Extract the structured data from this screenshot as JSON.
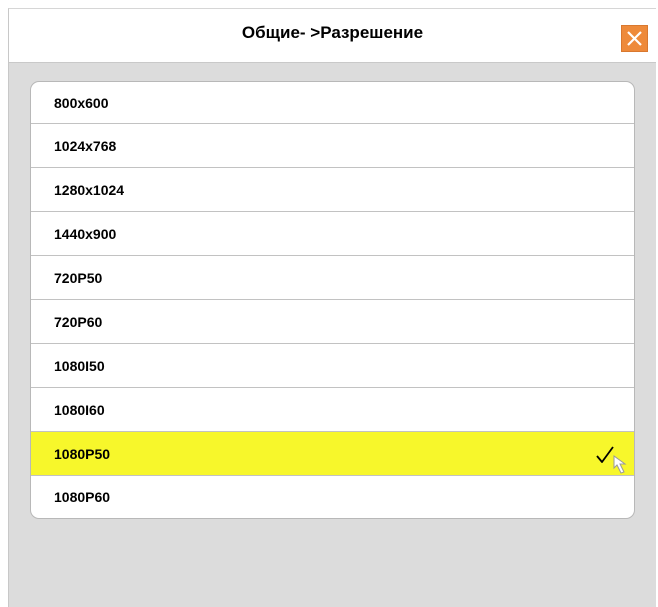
{
  "window": {
    "title": "Общие- >Разрешение"
  },
  "icons": {
    "close": "close-icon",
    "check": "checkmark-icon",
    "cursor": "pointer-cursor-icon"
  },
  "colors": {
    "close_button": "#ee8a3a",
    "selected_row": "#f7f72b",
    "background": "#dcdcdc"
  },
  "resolutions": [
    {
      "label": "800x600",
      "selected": false
    },
    {
      "label": "1024x768",
      "selected": false
    },
    {
      "label": "1280x1024",
      "selected": false
    },
    {
      "label": "1440x900",
      "selected": false
    },
    {
      "label": "720P50",
      "selected": false
    },
    {
      "label": "720P60",
      "selected": false
    },
    {
      "label": "1080I50",
      "selected": false
    },
    {
      "label": "1080I60",
      "selected": false
    },
    {
      "label": "1080P50",
      "selected": true
    },
    {
      "label": "1080P60",
      "selected": false
    }
  ]
}
